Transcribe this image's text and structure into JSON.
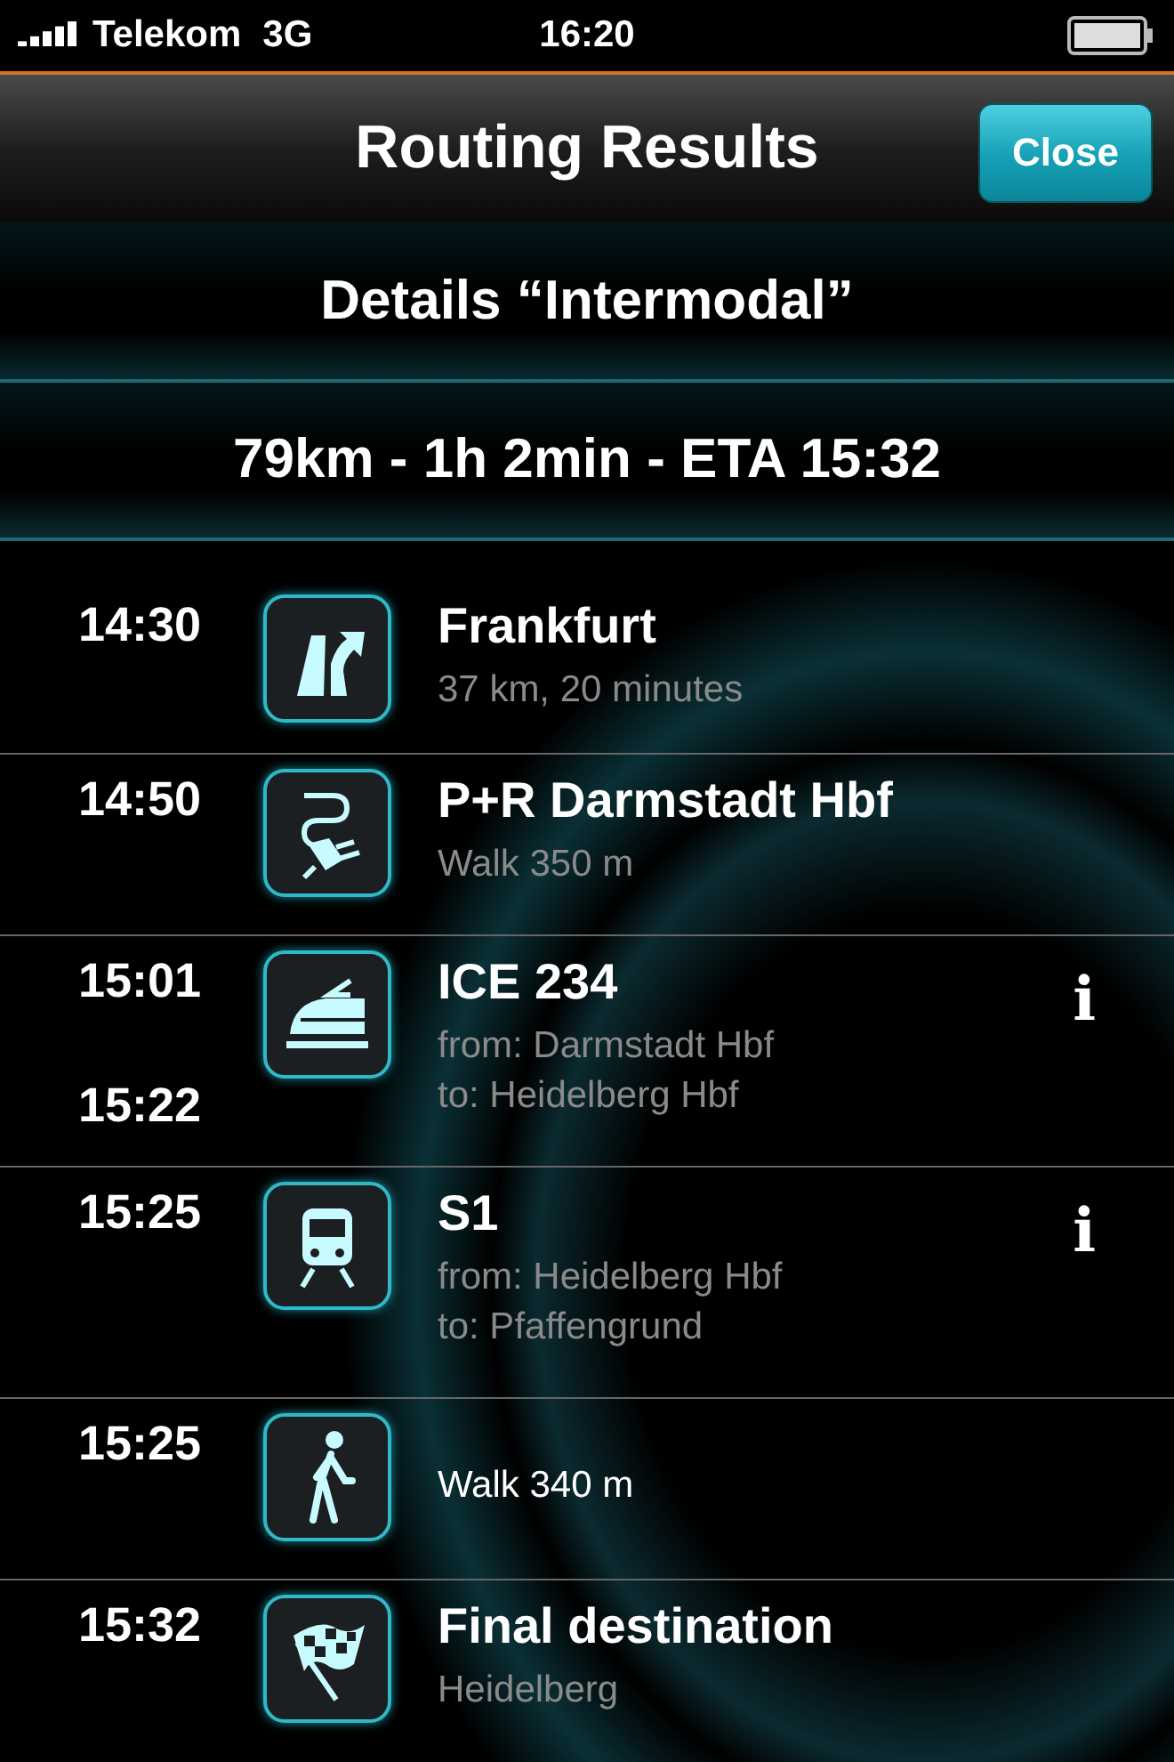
{
  "status_bar": {
    "carrier": "Telekom",
    "network": "3G",
    "time": "16:20"
  },
  "nav": {
    "title": "Routing Results",
    "close_button": "Close"
  },
  "header": "Details “Intermodal”",
  "summary": "79km - 1h 2min - ETA 15:32",
  "steps": [
    {
      "kind": "drive",
      "times": [
        "14:30"
      ],
      "title": "Frankfurt",
      "details": [
        "37 km, 20 minutes"
      ],
      "info": false
    },
    {
      "kind": "park",
      "times": [
        "14:50"
      ],
      "title": "P+R Darmstadt Hbf",
      "details": [
        "Walk 350 m"
      ],
      "info": false
    },
    {
      "kind": "ice",
      "times": [
        "15:01",
        "15:22"
      ],
      "title": "ICE 234",
      "details": [
        "from: Darmstadt Hbf",
        "to: Heidelberg Hbf"
      ],
      "info": true,
      "info_label": "i"
    },
    {
      "kind": "sbahn",
      "times": [
        "15:25"
      ],
      "title": "S1",
      "details": [
        "from: Heidelberg Hbf",
        "to: Pfaffengrund"
      ],
      "info": true,
      "info_label": "i"
    },
    {
      "kind": "walk",
      "times": [
        "15:25"
      ],
      "details": [
        "Walk 340 m"
      ],
      "info": false
    },
    {
      "kind": "finish",
      "times": [
        "15:32"
      ],
      "title": "Final destination",
      "details": [
        "Heidelberg"
      ],
      "info": false
    }
  ]
}
